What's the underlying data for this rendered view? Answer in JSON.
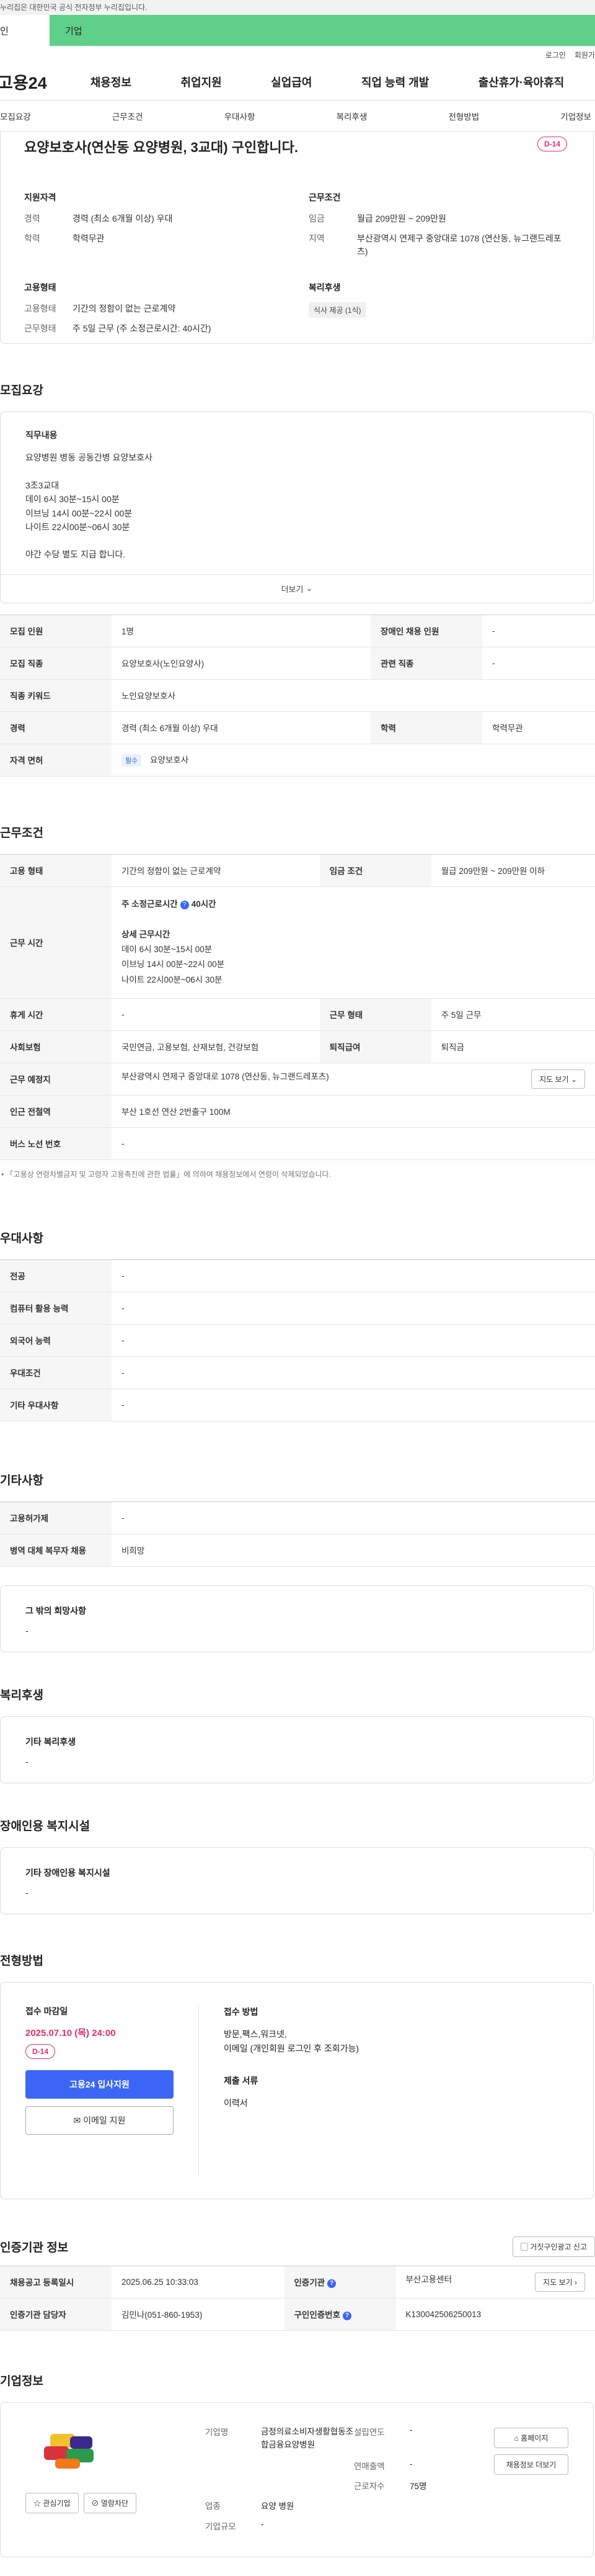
{
  "gov_notice": "누리집은 대한민국 공식 전자정부 누리집입니다.",
  "user_tabs": {
    "personal": "인",
    "corporate": "기업"
  },
  "util": {
    "login": "로그인",
    "signup": "회원가"
  },
  "logo": "고용24",
  "gnb": [
    "채용정보",
    "취업지원",
    "실업급여",
    "직업 능력 개발",
    "출산휴가·육아휴직"
  ],
  "lnb": [
    "모집요강",
    "근무조건",
    "우대사항",
    "복리후생",
    "전형방법",
    "기업정보"
  ],
  "job": {
    "title": "요양보호사(연산동 요양병원, 3교대) 구인합니다.",
    "dday": "D-14",
    "qual_title": "지원자격",
    "qual": [
      {
        "k": "경력",
        "v": "경력 (최소 6개월 이상) 우대"
      },
      {
        "k": "학력",
        "v": "학력무관"
      }
    ],
    "work_title": "근무조건",
    "work": [
      {
        "k": "임금",
        "v": "월급 209만원 ~ 209만원"
      },
      {
        "k": "지역",
        "v": "부산광역시 연제구 중앙대로 1078 (연산동, 뉴그랜드레포츠)"
      }
    ],
    "emp_title": "고용형태",
    "emp": [
      {
        "k": "고용형태",
        "v": "기간의 정함이 없는 근로계약"
      },
      {
        "k": "근무형태",
        "v": "주 5일 근무 (주 소정근로시간: 40시간)"
      }
    ],
    "welfare_title": "복리후생",
    "welfare_tag": "식사 제공 (1식)"
  },
  "recruit": {
    "section": "모집요강",
    "duty_title": "직무내용",
    "duty_lines": [
      "요양병원 병동 공동간병 요양보호사",
      "",
      "3조3교대",
      "데이 6시 30분~15시 00분",
      "이브닝 14시 00분~22시 00분",
      "나이트 22시00분~06시 30분",
      "",
      "야간 수당 별도 지급 합니다."
    ],
    "more": "더보기",
    "rows": [
      {
        "k1": "모집 인원",
        "v1": "1명",
        "k2": "장애인 채용 인원",
        "v2": "-"
      },
      {
        "k1": "모집 직종",
        "v1": "요양보호사(노인요양사)",
        "k2": "관련 직종",
        "v2": "-"
      },
      {
        "k1": "직종 키워드",
        "v1": "노인요양보호사"
      },
      {
        "k1": "경력",
        "v1": "경력 (최소 6개월 이상) 우대",
        "k2": "학력",
        "v2": "학력무관"
      }
    ],
    "license_label": "자격 면허",
    "license_tag": "필수",
    "license_value": "요양보호사"
  },
  "conditions": {
    "section": "근무조건",
    "emp_type_label": "고용 형태",
    "emp_type": "기간의 정함이 없는 근로계약",
    "wage_label": "임금 조건",
    "wage": "월급 209만원 ~ 209만원 이하",
    "worktime_label": "근무 시간",
    "weekly_title": "주 소정근로시간",
    "weekly_value": "40시간",
    "detail_title": "상세 근무시간",
    "detail_lines": [
      "데이 6시 30분~15시 00분",
      "이브닝 14시 00분~22시 00분",
      "나이트 22시00분~06시 30분"
    ],
    "rest_label": "휴게 시간",
    "rest": "-",
    "form_label": "근무 형태",
    "form": "주 5일 근무",
    "insurance_label": "사회보험",
    "insurance": "국민연금, 고용보험, 산재보험, 건강보험",
    "retire_label": "퇴직급여",
    "retire": "퇴직금",
    "place_label": "근무 예정지",
    "place": "부산광역시 연제구 중앙대로 1078 (연산동, 뉴그랜드레포츠)",
    "map_btn": "지도 보기",
    "subway_label": "인근 전철역",
    "subway": "부산 1호선 연산 2번출구 100M",
    "bus_label": "버스 노선 번호",
    "bus": "-",
    "note": "「고용상 연령차별금지 및 고령자 고용촉진에 관한 법률」에 의하여 채용정보에서 연령이 삭제되었습니다."
  },
  "prefer": {
    "section": "우대사항",
    "rows": [
      {
        "k": "전공",
        "v": "-"
      },
      {
        "k": "컴퓨터 활용 능력",
        "v": "-"
      },
      {
        "k": "외국어 능력",
        "v": "-"
      },
      {
        "k": "우대조건",
        "v": "-"
      },
      {
        "k": "기타 우대사항",
        "v": "-"
      }
    ]
  },
  "etc": {
    "section": "기타사항",
    "rows": [
      {
        "k": "고용허가제",
        "v": "-"
      },
      {
        "k": "병역 대체 복무자 채용",
        "v": "비희망"
      }
    ],
    "box_title": "그 밖의 희망사항",
    "box_value": "-"
  },
  "welfare": {
    "section": "복리후생",
    "box_title": "기타 복리후생",
    "box_value": "-"
  },
  "disabled": {
    "section": "장애인용 복지시설",
    "box_title": "기타 장애인용 복지시설",
    "box_value": "-"
  },
  "apply": {
    "section": "전형방법",
    "deadline_title": "접수 마감일",
    "deadline": "2025.07.10 (목) 24:00",
    "dday": "D-14",
    "btn_online": "고용24 입사지원",
    "btn_email": "이메일 지원",
    "method_title": "접수 방법",
    "methods": [
      "방문,팩스,워크넷,",
      "이메일 (개인회원 로그인 후 조회가능)"
    ],
    "docs_title": "제출 서류",
    "docs": "이력서"
  },
  "cert": {
    "section": "인증기관 정보",
    "report_btn": "거짓구인광고 신고",
    "reg_label": "채용공고 등록일시",
    "reg": "2025.06.25 10:33:03",
    "agency_label": "인증기관",
    "agency": "부산고용센터",
    "map_btn": "지도 보기",
    "manager_label": "인증기관 담당자",
    "manager": "김민나(051-860-1953)",
    "job_no_label": "구인인증번호",
    "job_no": "K130042506250013"
  },
  "company": {
    "section": "기업정보",
    "interest_btn": "관심기업",
    "block_btn": "열람차단",
    "fields": [
      {
        "k": "기업명",
        "v": "금정의료소비자생활협동조합금융요양병원"
      },
      {
        "k": "설립연도",
        "v": "-"
      },
      {
        "k": "연매출액",
        "v": "-"
      },
      {
        "k": "근로자수",
        "v": "75명"
      },
      {
        "k": "업종",
        "v": "요양 병원"
      },
      {
        "k": "기업규모",
        "v": "-"
      }
    ],
    "homepage_btn": "홈페이지",
    "more_btn": "채용정보 더보기"
  },
  "colors": {
    "accent": "#3b66f5",
    "dday": "#e1306c",
    "corp_tab": "#5fd08a"
  }
}
